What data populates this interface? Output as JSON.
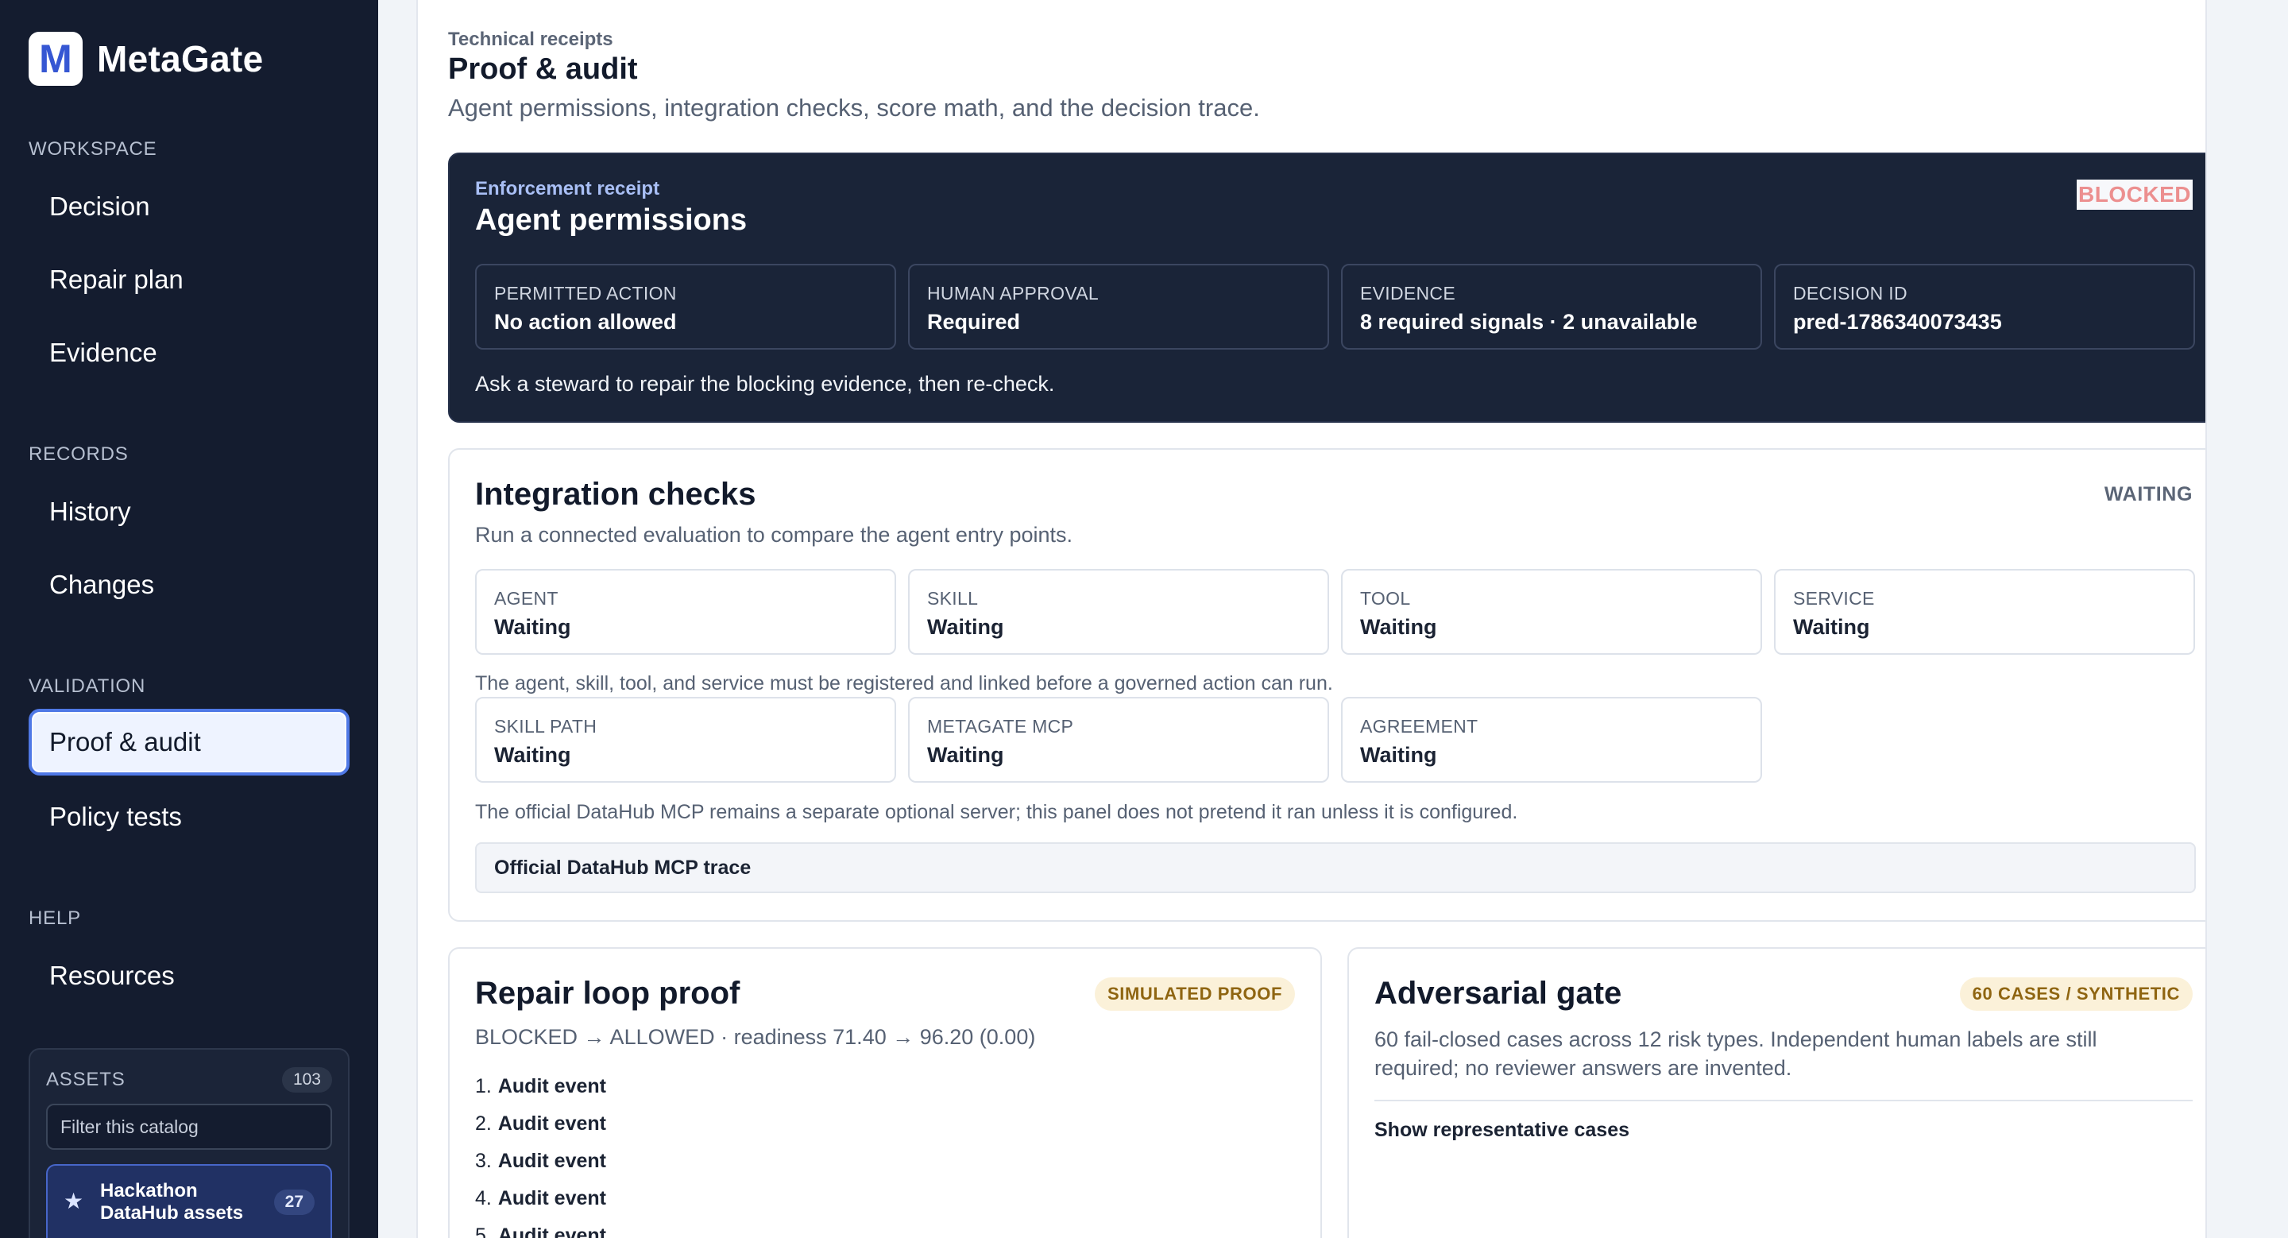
{
  "brand": {
    "logo_letter": "M",
    "name": "MetaGate"
  },
  "nav": {
    "workspace_label": "WORKSPACE",
    "workspace_items": [
      "Decision",
      "Repair plan",
      "Evidence"
    ],
    "records_label": "RECORDS",
    "records_items": [
      "History",
      "Changes"
    ],
    "validation_label": "VALIDATION",
    "validation_items": [
      "Proof & audit",
      "Policy tests"
    ],
    "help_label": "HELP",
    "help_items": [
      "Resources"
    ]
  },
  "assets": {
    "label": "ASSETS",
    "count": "103",
    "filter_placeholder": "Filter this catalog",
    "selected_item_label": "Hackathon DataHub assets",
    "selected_item_count": "27",
    "star_icon": "★"
  },
  "header": {
    "eyebrow": "Technical receipts",
    "title": "Proof & audit",
    "subtitle": "Agent permissions, integration checks, score math, and the decision trace."
  },
  "receipt": {
    "eyebrow": "Enforcement receipt",
    "title": "Agent permissions",
    "status": "BLOCKED",
    "cards": [
      {
        "label": "PERMITTED ACTION",
        "value": "No action allowed"
      },
      {
        "label": "HUMAN APPROVAL",
        "value": "Required"
      },
      {
        "label": "EVIDENCE",
        "value": "8 required signals · 2 unavailable"
      },
      {
        "label": "DECISION ID",
        "value": "pred-1786340073435"
      }
    ],
    "note": "Ask a steward to repair the blocking evidence, then re-check."
  },
  "integration": {
    "title": "Integration checks",
    "status": "WAITING",
    "subtitle": "Run a connected evaluation to compare the agent entry points.",
    "row1": [
      {
        "label": "AGENT",
        "value": "Waiting"
      },
      {
        "label": "SKILL",
        "value": "Waiting"
      },
      {
        "label": "TOOL",
        "value": "Waiting"
      },
      {
        "label": "SERVICE",
        "value": "Waiting"
      }
    ],
    "note1": "The agent, skill, tool, and service must be registered and linked before a governed action can run.",
    "row2": [
      {
        "label": "SKILL PATH",
        "value": "Waiting"
      },
      {
        "label": "METAGATE MCP",
        "value": "Waiting"
      },
      {
        "label": "AGREEMENT",
        "value": "Waiting"
      }
    ],
    "note2": "The official DataHub MCP remains a separate optional server; this panel does not pretend it ran unless it is configured.",
    "trace_label": "Official DataHub MCP trace"
  },
  "repair_loop": {
    "title": "Repair loop proof",
    "badge": "SIMULATED PROOF",
    "subtitle": "BLOCKED → ALLOWED · readiness 71.40 → 96.20 (0.00)",
    "events": [
      "Audit event",
      "Audit event",
      "Audit event",
      "Audit event",
      "Audit event"
    ]
  },
  "adversarial": {
    "title": "Adversarial gate",
    "badge": "60 CASES / SYNTHETIC",
    "subtitle": "60 fail-closed cases across 12 risk types. Independent human labels are still required; no reviewer answers are invented.",
    "link": "Show representative cases"
  },
  "colors": {
    "sidebar_bg": "#141c2f",
    "accent": "#4f78e6",
    "receipt_bg": "#1a2438",
    "blocked": "#ec8f8f",
    "badge_bg": "#fbf1d9",
    "badge_text": "#8f6511"
  }
}
